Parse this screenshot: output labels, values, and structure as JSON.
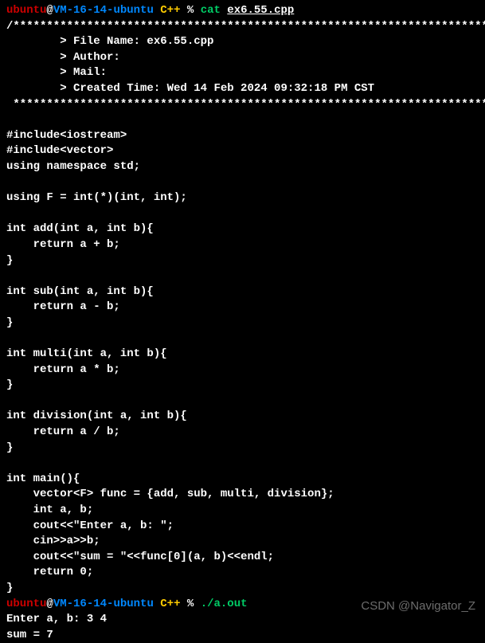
{
  "prompt1": {
    "user": "ubuntu",
    "at": "@",
    "host": "VM-16-14-ubuntu",
    "dir": " C++",
    "percent": " % ",
    "cmd": "cat ",
    "arg": "ex6.55.cpp"
  },
  "code": [
    "/*************************************************************************",
    "        > File Name: ex6.55.cpp",
    "        > Author:",
    "        > Mail:",
    "        > Created Time: Wed 14 Feb 2024 09:32:18 PM CST",
    " ************************************************************************/",
    "",
    "#include<iostream>",
    "#include<vector>",
    "using namespace std;",
    "",
    "using F = int(*)(int, int);",
    "",
    "int add(int a, int b){",
    "    return a + b;",
    "}",
    "",
    "int sub(int a, int b){",
    "    return a - b;",
    "}",
    "",
    "int multi(int a, int b){",
    "    return a * b;",
    "}",
    "",
    "int division(int a, int b){",
    "    return a / b;",
    "}",
    "",
    "int main(){",
    "    vector<F> func = {add, sub, multi, division};",
    "    int a, b;",
    "    cout<<\"Enter a, b: \";",
    "    cin>>a>>b;",
    "    cout<<\"sum = \"<<func[0](a, b)<<endl;",
    "    return 0;",
    "}"
  ],
  "prompt2": {
    "user": "ubuntu",
    "at": "@",
    "host": "VM-16-14-ubuntu",
    "dir": " C++",
    "percent": " % ",
    "cmd": "./a.out"
  },
  "output": [
    "Enter a, b: 3 4",
    "sum = 7"
  ],
  "watermark": "CSDN @Navigator_Z"
}
